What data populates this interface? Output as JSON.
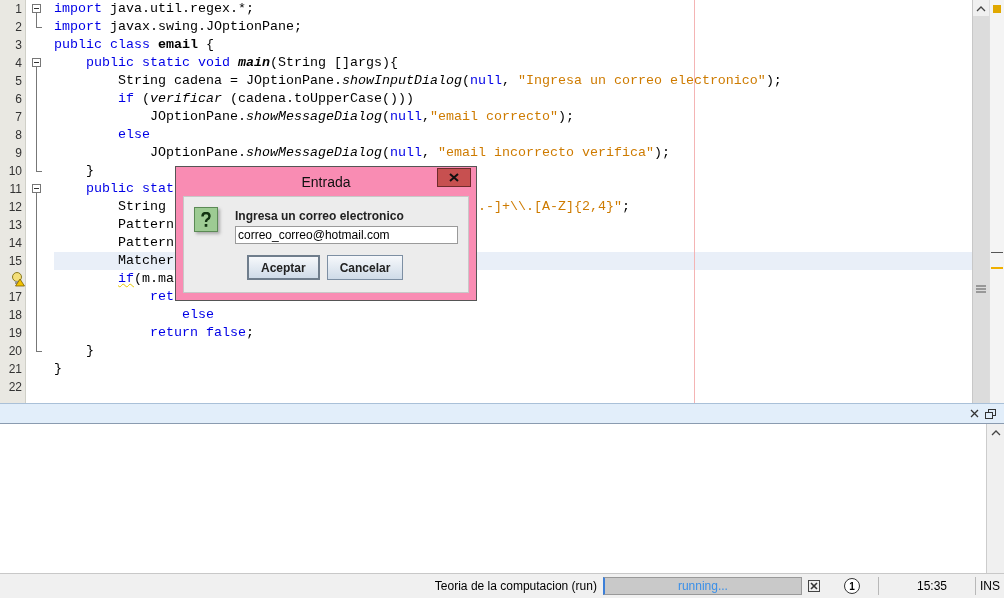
{
  "editor": {
    "lines": [
      {
        "number": "1",
        "fold_start": true,
        "fold_end": false,
        "current": false,
        "hint": false,
        "tokens": [
          {
            "kind": "kw",
            "text": "import"
          },
          {
            "kind": "pl",
            "text": " java.util.regex.*;"
          }
        ]
      },
      {
        "number": "2",
        "fold_start": false,
        "fold_end": true,
        "current": false,
        "hint": false,
        "tokens": [
          {
            "kind": "kw",
            "text": "import"
          },
          {
            "kind": "pl",
            "text": " javax.swing.JOptionPane;"
          }
        ]
      },
      {
        "number": "3",
        "fold_start": false,
        "fold_end": false,
        "current": false,
        "hint": false,
        "tokens": [
          {
            "kind": "kw",
            "text": "public class"
          },
          {
            "kind": "b",
            "text": " email"
          },
          {
            "kind": "pl",
            "text": " {"
          }
        ]
      },
      {
        "number": "4",
        "fold_start": true,
        "fold_end": false,
        "current": false,
        "hint": false,
        "tokens": [
          {
            "kind": "kw",
            "text": "    public static void"
          },
          {
            "kind": "bi",
            "text": " main"
          },
          {
            "kind": "pl",
            "text": "(String []args){"
          }
        ]
      },
      {
        "number": "5",
        "fold_start": false,
        "fold_end": false,
        "current": false,
        "hint": false,
        "tokens": [
          {
            "kind": "pl",
            "text": "        String cadena = JOptionPane."
          },
          {
            "kind": "it",
            "text": "showInputDialog"
          },
          {
            "kind": "pl",
            "text": "("
          },
          {
            "kind": "kw",
            "text": "null"
          },
          {
            "kind": "pl",
            "text": ","
          },
          {
            "kind": "str",
            "text": " \"Ingresa un correo electronico\""
          },
          {
            "kind": "pl",
            "text": ");"
          }
        ]
      },
      {
        "number": "6",
        "fold_start": false,
        "fold_end": false,
        "current": false,
        "hint": false,
        "tokens": [
          {
            "kind": "kw",
            "text": "        if"
          },
          {
            "kind": "pl",
            "text": " ("
          },
          {
            "kind": "it",
            "text": "verificar"
          },
          {
            "kind": "pl",
            "text": " (cadena.toUpperCase()))"
          }
        ]
      },
      {
        "number": "7",
        "fold_start": false,
        "fold_end": false,
        "current": false,
        "hint": false,
        "tokens": [
          {
            "kind": "pl",
            "text": "            JOptionPane."
          },
          {
            "kind": "it",
            "text": "showMessageDialog"
          },
          {
            "kind": "pl",
            "text": "("
          },
          {
            "kind": "kw",
            "text": "null"
          },
          {
            "kind": "pl",
            "text": ","
          },
          {
            "kind": "str",
            "text": "\"email correcto\""
          },
          {
            "kind": "pl",
            "text": ");"
          }
        ]
      },
      {
        "number": "8",
        "fold_start": false,
        "fold_end": false,
        "current": false,
        "hint": false,
        "tokens": [
          {
            "kind": "kw",
            "text": "        else"
          }
        ]
      },
      {
        "number": "9",
        "fold_start": false,
        "fold_end": false,
        "current": false,
        "hint": false,
        "tokens": [
          {
            "kind": "pl",
            "text": "            JOptionPane."
          },
          {
            "kind": "it",
            "text": "showMessageDialog"
          },
          {
            "kind": "pl",
            "text": "("
          },
          {
            "kind": "kw",
            "text": "null"
          },
          {
            "kind": "pl",
            "text": ","
          },
          {
            "kind": "str",
            "text": " \"email incorrecto verifica\""
          },
          {
            "kind": "pl",
            "text": ");"
          }
        ]
      },
      {
        "number": "10",
        "fold_start": false,
        "fold_end": true,
        "current": false,
        "hint": false,
        "tokens": [
          {
            "kind": "pl",
            "text": "    }"
          }
        ]
      },
      {
        "number": "11",
        "fold_start": true,
        "fold_end": false,
        "current": false,
        "hint": false,
        "tokens": [
          {
            "kind": "kw",
            "text": "    public stat"
          }
        ]
      },
      {
        "number": "12",
        "fold_start": false,
        "fold_end": false,
        "current": false,
        "hint": false,
        "tokens": [
          {
            "kind": "pl",
            "text": "        String"
          },
          {
            "kind": "str",
            "text": "                                       .-]+\\\\.[A-Z]{2,4}\""
          },
          {
            "kind": "pl",
            "text": ";"
          }
        ]
      },
      {
        "number": "13",
        "fold_start": false,
        "fold_end": false,
        "current": false,
        "hint": false,
        "tokens": [
          {
            "kind": "pl",
            "text": "        Pattern"
          }
        ]
      },
      {
        "number": "14",
        "fold_start": false,
        "fold_end": false,
        "current": false,
        "hint": false,
        "tokens": [
          {
            "kind": "pl",
            "text": "        Pattern"
          }
        ]
      },
      {
        "number": "15",
        "fold_start": false,
        "fold_end": false,
        "current": true,
        "hint": false,
        "tokens": [
          {
            "kind": "pl",
            "text": "        Matcher"
          }
        ]
      },
      {
        "fold_start": false,
        "fold_end": false,
        "current": false,
        "hint": true,
        "tokens": [
          {
            "kind": "warn",
            "text": "        if"
          },
          {
            "kind": "pl",
            "text": "(m.ma"
          }
        ]
      },
      {
        "number": "17",
        "fold_start": false,
        "fold_end": false,
        "current": false,
        "hint": false,
        "tokens": [
          {
            "kind": "kw",
            "text": "            ret"
          }
        ]
      },
      {
        "number": "18",
        "fold_start": false,
        "fold_end": false,
        "current": false,
        "hint": false,
        "tokens": [
          {
            "kind": "kw",
            "text": "                else"
          }
        ]
      },
      {
        "number": "19",
        "fold_start": false,
        "fold_end": false,
        "current": false,
        "hint": false,
        "tokens": [
          {
            "kind": "kw",
            "text": "            return false"
          },
          {
            "kind": "pl",
            "text": ";"
          }
        ]
      },
      {
        "number": "20",
        "fold_start": false,
        "fold_end": true,
        "current": false,
        "hint": false,
        "tokens": [
          {
            "kind": "pl",
            "text": "    }"
          }
        ]
      },
      {
        "number": "21",
        "fold_start": false,
        "fold_end": false,
        "current": false,
        "hint": false,
        "tokens": [
          {
            "kind": "pl",
            "text": "}"
          }
        ]
      },
      {
        "number": "22",
        "fold_start": false,
        "fold_end": false,
        "current": false,
        "hint": false
      }
    ]
  },
  "dialog": {
    "title": "Entrada",
    "message": "Ingresa un correo electronico",
    "value": "correo_correo@hotmail.com",
    "buttons": [
      {
        "label": "Aceptar",
        "focused": true
      },
      {
        "label": "Cancelar",
        "focused": false
      }
    ]
  },
  "status_bar": {
    "project": "Teoria de la computacion (run)",
    "progress_text": "running...",
    "level": 1,
    "notifications": "1",
    "time": "15:35",
    "mode": "INS"
  }
}
